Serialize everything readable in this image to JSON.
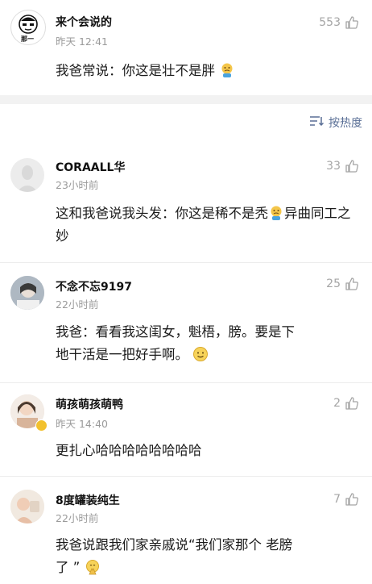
{
  "top_comment": {
    "username": "来个会说的",
    "time": "昨天 12:41",
    "likes": "553",
    "text": "我爸常说：你这是壮不是胖",
    "avatar_caption": "那一"
  },
  "sort": {
    "label": "按热度"
  },
  "replies": [
    {
      "username": "CORAALL华",
      "time": "23小时前",
      "likes": "33",
      "text_a": "这和我爸说我头发：你这是稀不是秃",
      "text_b": "异曲同工之妙"
    },
    {
      "username": "不念不忘9197",
      "time": "22小时前",
      "likes": "25",
      "text_a": "我爸：看看我这闺女，魁梧，膀。要是下",
      "text_b": "地干活是一把好手啊。"
    },
    {
      "username": "萌孩萌孩萌鸭",
      "time": "昨天 14:40",
      "likes": "2",
      "text_a": "更扎心哈哈哈哈哈哈哈哈"
    },
    {
      "username": "8度罐装纯生",
      "time": "22小时前",
      "likes": "7",
      "text_a": "我爸说跟我们家亲戚说“我们家那个 老膀",
      "text_b": "了 ”"
    }
  ],
  "colors": {
    "link": "#5a6f96",
    "meta": "#9a9a9a",
    "badge": "#f2c12e"
  }
}
